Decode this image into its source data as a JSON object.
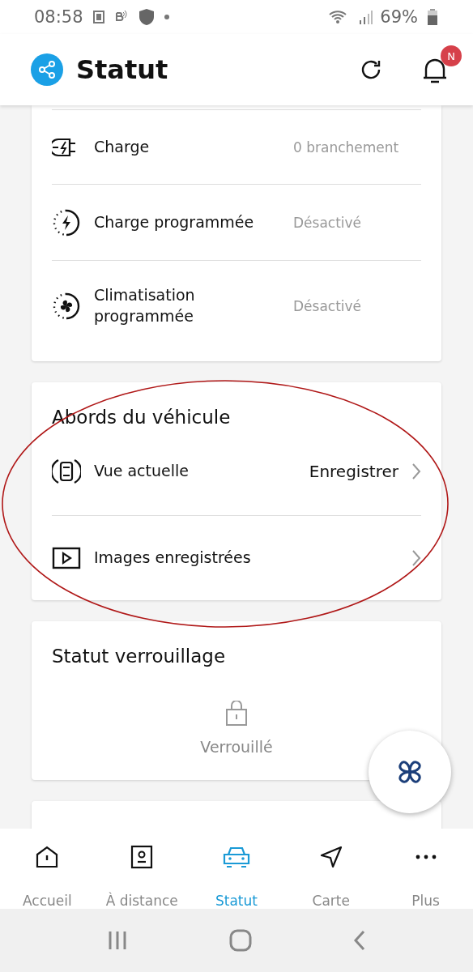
{
  "status_bar": {
    "time": "08:58",
    "battery": "69%"
  },
  "header": {
    "title": "Statut",
    "notification_badge": "N"
  },
  "charging_card": {
    "rows": [
      {
        "kind": "plug",
        "label": "Charge",
        "value": "0 branchement"
      },
      {
        "kind": "bolt-timer",
        "label": "Charge programmée",
        "value": "Désactivé"
      },
      {
        "kind": "fan-timer",
        "label": "Climatisation programmée",
        "value": "Désactivé"
      }
    ]
  },
  "surroundings_card": {
    "title": "Abords du véhicule",
    "rows": [
      {
        "kind": "car-view",
        "label": "Vue actuelle",
        "action": "Enregistrer"
      },
      {
        "kind": "play",
        "label": "Images enregistrées"
      }
    ]
  },
  "lock_card": {
    "title": "Statut verrouillage",
    "status": "Verrouillé"
  },
  "bottom_nav": [
    {
      "kind": "home",
      "label": "Accueil",
      "selected": false
    },
    {
      "kind": "remote",
      "label": "À distance",
      "selected": false
    },
    {
      "kind": "car",
      "label": "Statut",
      "selected": true
    },
    {
      "kind": "map",
      "label": "Carte",
      "selected": false
    },
    {
      "kind": "more",
      "label": "Plus",
      "selected": false
    }
  ]
}
